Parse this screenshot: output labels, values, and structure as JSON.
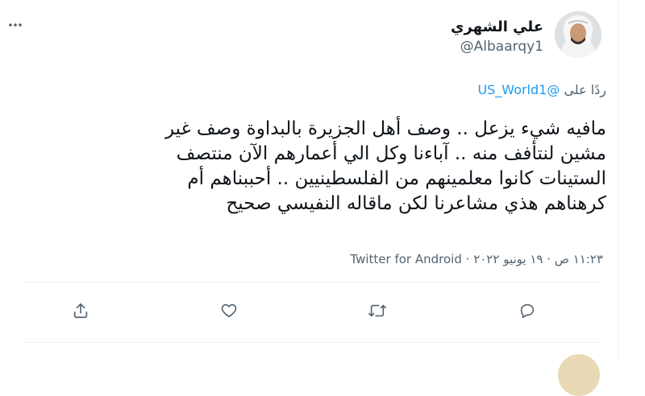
{
  "tweet": {
    "display_name": "علي الشهري",
    "handle": "@Albaarqy1",
    "reply_prefix": "ردًا على",
    "reply_to": "@US_World1",
    "text_lines": [
      "مافيه شيء يزعل .. وصف أهل الجزيرة بالبداوة وصف غير",
      "مشين لنتأفف منه .. آباءنا وكل الي أعمارهم الآن منتصف",
      "الستينات كانوا معلمينهم من الفلسطينيين .. أحببناهم أم",
      "كرهناهم هذي مشاعرنا لكن ماقاله النفيسي صحيح"
    ],
    "time": "١١:٢٣ ص",
    "date": "١٩ يونيو ٢٠٢٢",
    "separator": "·",
    "source": "Twitter for Android"
  },
  "icons": {
    "more": "more-dots-icon",
    "share": "share-icon",
    "like": "heart-icon",
    "retweet": "retweet-icon",
    "reply": "reply-icon"
  },
  "colors": {
    "text": "#0f1419",
    "secondary": "#536471",
    "accent": "#1d9bf0",
    "border": "#eff3f4"
  }
}
